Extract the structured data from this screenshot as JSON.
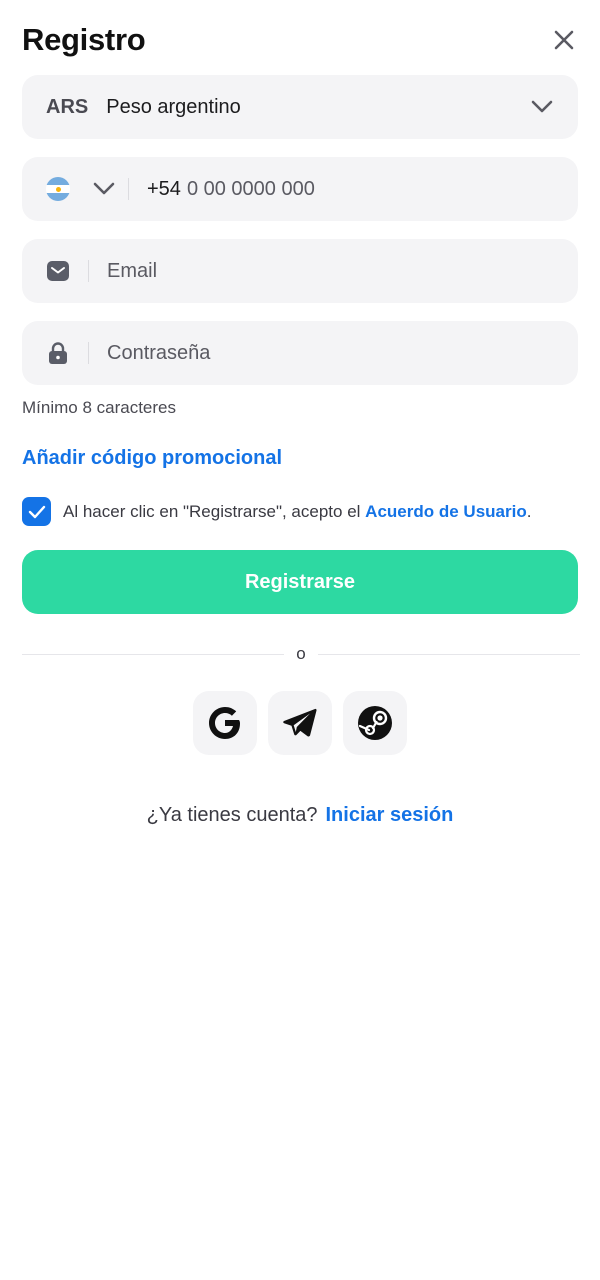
{
  "header": {
    "title": "Registro"
  },
  "currency": {
    "code": "ARS",
    "name": "Peso argentino"
  },
  "phone": {
    "prefix": "+54",
    "placeholder": "0 00 0000 000"
  },
  "email": {
    "placeholder": "Email"
  },
  "password": {
    "placeholder": "Contraseña",
    "hint": "Mínimo 8 caracteres"
  },
  "promo": {
    "link_label": "Añadir código promocional"
  },
  "agreement": {
    "checked": true,
    "text": "Al hacer clic en \"Registrarse\", acepto el",
    "link_label": "Acuerdo de Usuario",
    "suffix": "."
  },
  "submit": {
    "label": "Registrarse"
  },
  "divider": {
    "label": "o"
  },
  "social": {
    "items": [
      {
        "icon": "google-icon"
      },
      {
        "icon": "telegram-icon"
      },
      {
        "icon": "steam-icon"
      }
    ]
  },
  "login": {
    "prompt": "¿Ya tienes cuenta?",
    "link_label": "Iniciar sesión"
  },
  "colors": {
    "accent": "#1473e6",
    "primary_button": "#2dd9a2",
    "field_bg": "#f4f4f6"
  }
}
